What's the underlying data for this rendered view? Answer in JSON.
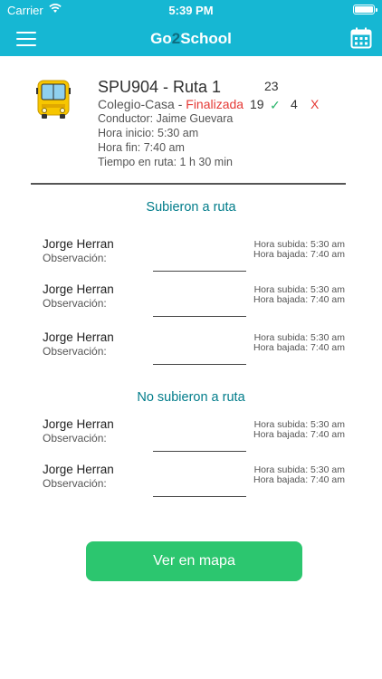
{
  "status_bar": {
    "carrier": "Carrier",
    "time": "5:39 PM"
  },
  "nav": {
    "logo_prefix": "Go",
    "logo_two": "2",
    "logo_suffix": "School"
  },
  "route": {
    "title": "SPU904 - Ruta 1",
    "direction": "Colegio-Casa - ",
    "status": "Finalizada",
    "driver": "Conductor: Jaime Guevara",
    "start": "Hora inicio: 5:30 am",
    "end": "Hora fin: 7:40 am",
    "duration": "Tiempo en ruta: 1 h 30 min",
    "total": "23",
    "boarded": "19",
    "boarded_mark": "✓",
    "not_boarded": "4",
    "not_boarded_mark": "X"
  },
  "sections": {
    "boarded_title": "Subieron a ruta",
    "not_boarded_title": "No subieron a ruta"
  },
  "boarded": [
    {
      "name": "Jorge Herran",
      "observation": "Observación:",
      "pickup": "Hora subida: 5:30 am",
      "dropoff": "Hora bajada: 7:40 am"
    },
    {
      "name": "Jorge Herran",
      "observation": "Observación:",
      "pickup": "Hora subida: 5:30 am",
      "dropoff": "Hora bajada: 7:40 am"
    },
    {
      "name": "Jorge Herran",
      "observation": "Observación:",
      "pickup": "Hora subida: 5:30 am",
      "dropoff": "Hora bajada: 7:40 am"
    }
  ],
  "not_boarded": [
    {
      "name": "Jorge Herran",
      "observation": "Observación:",
      "pickup": "Hora subida: 5:30 am",
      "dropoff": "Hora bajada: 7:40 am"
    },
    {
      "name": "Jorge Herran",
      "observation": "Observación:",
      "pickup": "Hora subida: 5:30 am",
      "dropoff": "Hora bajada: 7:40 am"
    }
  ],
  "actions": {
    "map_button": "Ver en mapa"
  },
  "colors": {
    "header": "#16b7d3",
    "accent_text": "#007c8a",
    "button": "#2cc66f",
    "finalized": "#e53935",
    "check": "#2ab56b"
  },
  "icons": {
    "menu": "hamburger-menu-icon",
    "calendar": "calendar-icon",
    "bus": "bus-icon",
    "wifi": "wifi-icon",
    "battery": "battery-icon"
  }
}
